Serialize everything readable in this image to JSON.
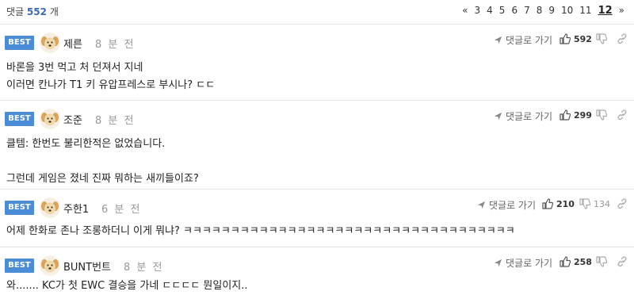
{
  "header": {
    "count_prefix": "댓글",
    "count": "552",
    "count_suffix": "개",
    "pager": {
      "first": "«",
      "pages": [
        "3",
        "4",
        "5",
        "6",
        "7",
        "8",
        "9",
        "10",
        "11"
      ],
      "current": "12",
      "last": "»"
    }
  },
  "comments": [
    {
      "badge": "BEST",
      "nick": "제른",
      "time": "8 분 전",
      "reply_label": "댓글로 가기",
      "likes": "592",
      "dislikes": "",
      "lines": [
        "바론을 3번 먹고 처 던져서 지네",
        "이러면 칸나가 T1 키 유압프레스로 부시나? ㄷㄷ"
      ]
    },
    {
      "badge": "BEST",
      "nick": "조준",
      "time": "8 분 전",
      "reply_label": "댓글로 가기",
      "likes": "299",
      "dislikes": "",
      "lines": [
        "클템: 한번도 불리한적은 없었습니다.",
        "",
        "그런데 게임은 졌네 진짜 뭐하는 새끼들이죠?"
      ]
    },
    {
      "badge": "BEST",
      "nick": "주한1",
      "time": "6 분 전",
      "reply_label": "댓글로 가기",
      "likes": "210",
      "dislikes": "134",
      "lines": [
        "어제 한화로 존나 조롱하더니 이게 뭐냐? ㅋㅋㅋㅋㅋㅋㅋㅋㅋㅋㅋㅋㅋㅋㅋㅋㅋㅋㅋㅋㅋㅋㅋㅋㅋㅋㅋㅋㅋㅋㅋㅋㅋㅋㅋ"
      ]
    },
    {
      "badge": "BEST",
      "nick": "BUNT번트",
      "time": "8 분 전",
      "reply_label": "댓글로 가기",
      "likes": "258",
      "dislikes": "",
      "lines": [
        "와....... KC가 첫 EWC 결승을 가네 ㄷㄷㄷㄷ 뭔일이지.."
      ]
    }
  ],
  "colors": {
    "best_badge": "#4a8cd6",
    "count_number": "#3c69b4",
    "divider": "#e3e3e3"
  },
  "icons": {
    "reply": "send-arrow-icon",
    "like": "thumbs-up-icon",
    "dislike": "thumbs-down-icon",
    "link": "link-icon",
    "avatar": "dog-avatar-icon"
  }
}
